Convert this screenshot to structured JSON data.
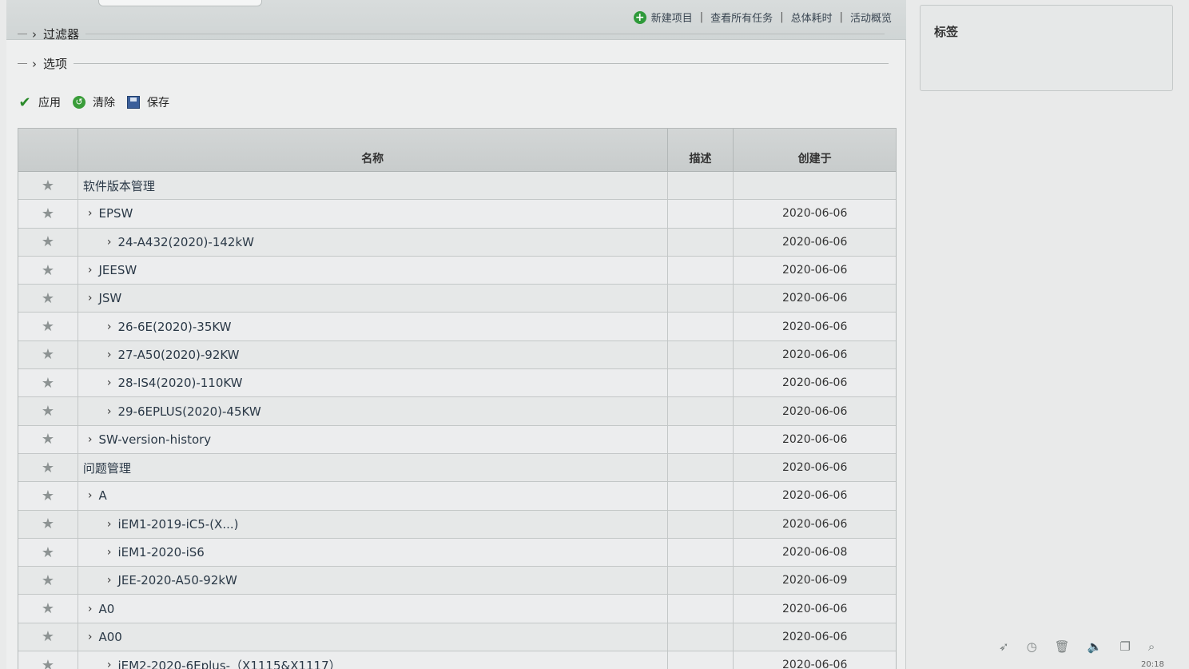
{
  "toplinks": {
    "new_project": "新建项目",
    "view_tasks": "查看所有任务",
    "total_time": "总体耗时",
    "activity": "活动概览",
    "sep": "|"
  },
  "sections": {
    "filter": "过滤器",
    "options": "选项"
  },
  "actions": {
    "apply": "应用",
    "clear": "清除",
    "save": "保存"
  },
  "table": {
    "headers": {
      "name": "名称",
      "desc": "描述",
      "created": "创建于"
    },
    "rows": [
      {
        "name": "软件版本管理",
        "desc": "",
        "date": ""
      },
      {
        "name": "EPSW",
        "desc": "",
        "date": "2020-06-06"
      },
      {
        "name": "24-A432(2020)-142kW",
        "desc": "",
        "date": "2020-06-06"
      },
      {
        "name": "JEESW",
        "desc": "",
        "date": "2020-06-06"
      },
      {
        "name": "JSW",
        "desc": "",
        "date": "2020-06-06"
      },
      {
        "name": "26-6E(2020)-35KW",
        "desc": "",
        "date": "2020-06-06"
      },
      {
        "name": "27-A50(2020)-92KW",
        "desc": "",
        "date": "2020-06-06"
      },
      {
        "name": "28-IS4(2020)-110KW",
        "desc": "",
        "date": "2020-06-06"
      },
      {
        "name": "29-6EPLUS(2020)-45KW",
        "desc": "",
        "date": "2020-06-06"
      },
      {
        "name": "SW-version-history",
        "desc": "",
        "date": "2020-06-06"
      },
      {
        "name": "问题管理",
        "desc": "",
        "date": "2020-06-06"
      },
      {
        "name": "A",
        "desc": "",
        "date": "2020-06-06"
      },
      {
        "name": "iEM1-2019-iC5-(X...)",
        "desc": "",
        "date": "2020-06-06"
      },
      {
        "name": "iEM1-2020-iS6",
        "desc": "",
        "date": "2020-06-08"
      },
      {
        "name": "JEE-2020-A50-92kW",
        "desc": "",
        "date": "2020-06-09"
      },
      {
        "name": "A0",
        "desc": "",
        "date": "2020-06-06"
      },
      {
        "name": "A00",
        "desc": "",
        "date": "2020-06-06"
      },
      {
        "name": "iEM2-2020-6Eplus-（X1115&X1117）",
        "desc": "",
        "date": "2020-06-06"
      }
    ]
  },
  "tags_panel": {
    "title": "标签"
  },
  "clock": "20:18"
}
